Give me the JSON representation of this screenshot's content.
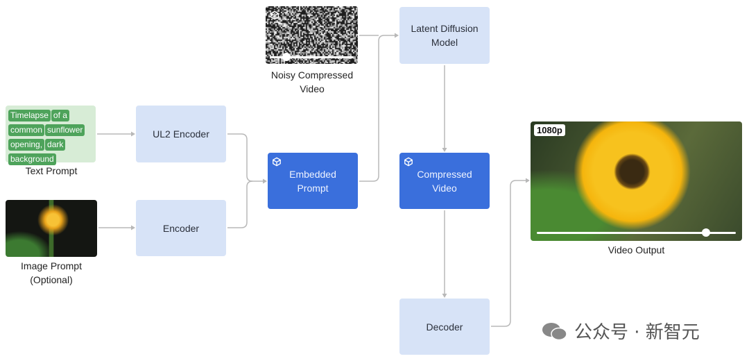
{
  "text_prompt": {
    "words": [
      "Timelapse",
      "of a",
      "common",
      "sunflower",
      "opening,",
      "dark",
      "background"
    ],
    "label": "Text Prompt"
  },
  "image_prompt": {
    "label_line1": "Image Prompt",
    "label_line2": "(Optional)"
  },
  "ul2_encoder": "UL2 Encoder",
  "encoder": "Encoder",
  "embedded_prompt": {
    "line1": "Embedded",
    "line2": "Prompt"
  },
  "noisy_video": {
    "line1": "Noisy Compressed",
    "line2": "Video",
    "progress": 0.2
  },
  "latent_diffusion": {
    "line1": "Latent Diffusion",
    "line2": "Model"
  },
  "compressed_video": {
    "line1": "Compressed",
    "line2": "Video"
  },
  "decoder": "Decoder",
  "video_output": {
    "badge": "1080p",
    "label": "Video Output",
    "progress": 0.85
  },
  "watermark": "公众号 · 新智元",
  "colors": {
    "light_box": "#d7e3f7",
    "dark_box": "#3a6fdc",
    "chip": "#4ea35b",
    "chip_bg": "#d7ecd6",
    "wire": "#b8b8b8"
  }
}
